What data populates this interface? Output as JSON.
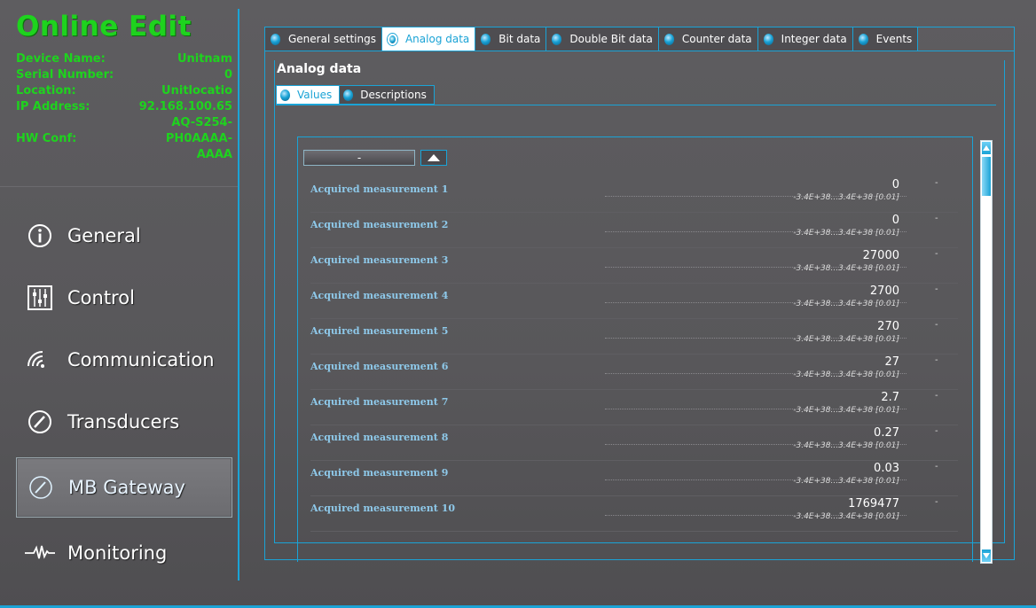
{
  "app": {
    "title": "Online Edit"
  },
  "device": [
    {
      "label": "Device Name:",
      "value": "Unitnam"
    },
    {
      "label": "Serial Number:",
      "value": "0"
    },
    {
      "label": "Location:",
      "value": "Unitlocatio"
    },
    {
      "label": "IP Address:",
      "value": "92.168.100.65"
    },
    {
      "label": "",
      "value": "AQ-S254-"
    },
    {
      "label": "HW Conf:",
      "value": "PH0AAAA-"
    },
    {
      "label": "",
      "value": "AAAA"
    }
  ],
  "nav": {
    "items": [
      {
        "label": "General",
        "icon": "info-icon"
      },
      {
        "label": "Control",
        "icon": "sliders-icon"
      },
      {
        "label": "Communication",
        "icon": "wifi-icon"
      },
      {
        "label": "Transducers",
        "icon": "gauge-icon"
      },
      {
        "label": "MB Gateway",
        "icon": "gauge-icon",
        "active": true
      },
      {
        "label": "Monitoring",
        "icon": "waveform-icon"
      }
    ]
  },
  "tabs": [
    {
      "label": "General settings"
    },
    {
      "label": "Analog data",
      "active": true
    },
    {
      "label": "Bit data"
    },
    {
      "label": "Double Bit data"
    },
    {
      "label": "Counter data"
    },
    {
      "label": "Integer data"
    },
    {
      "label": "Events"
    }
  ],
  "section": {
    "title": "Analog data"
  },
  "subtabs": [
    {
      "label": "Values",
      "active": true
    },
    {
      "label": "Descriptions"
    }
  ],
  "controls": {
    "dash_label": "-"
  },
  "rows": [
    {
      "name": "Acquired measurement 1",
      "value": "0",
      "range": "-3.4E+38...3.4E+38 [0.01]",
      "unit": "-"
    },
    {
      "name": "Acquired measurement 2",
      "value": "0",
      "range": "-3.4E+38...3.4E+38 [0.01]",
      "unit": "-"
    },
    {
      "name": "Acquired measurement 3",
      "value": "27000",
      "range": "-3.4E+38...3.4E+38 [0.01]",
      "unit": "-"
    },
    {
      "name": "Acquired measurement 4",
      "value": "2700",
      "range": "-3.4E+38...3.4E+38 [0.01]",
      "unit": "-"
    },
    {
      "name": "Acquired measurement 5",
      "value": "270",
      "range": "-3.4E+38...3.4E+38 [0.01]",
      "unit": "-"
    },
    {
      "name": "Acquired measurement 6",
      "value": "27",
      "range": "-3.4E+38...3.4E+38 [0.01]",
      "unit": "-"
    },
    {
      "name": "Acquired measurement 7",
      "value": "2.7",
      "range": "-3.4E+38...3.4E+38 [0.01]",
      "unit": "-"
    },
    {
      "name": "Acquired measurement 8",
      "value": "0.27",
      "range": "-3.4E+38...3.4E+38 [0.01]",
      "unit": "-"
    },
    {
      "name": "Acquired measurement 9",
      "value": "0.03",
      "range": "-3.4E+38...3.4E+38 [0.01]",
      "unit": "-"
    },
    {
      "name": "Acquired measurement 10",
      "value": "1769477",
      "range": "-3.4E+38...3.4E+38 [0.01]",
      "unit": "-"
    }
  ],
  "colors": {
    "accent": "#1aa3d6",
    "green": "#1ed31e",
    "label_blue": "#8ec9ea"
  }
}
